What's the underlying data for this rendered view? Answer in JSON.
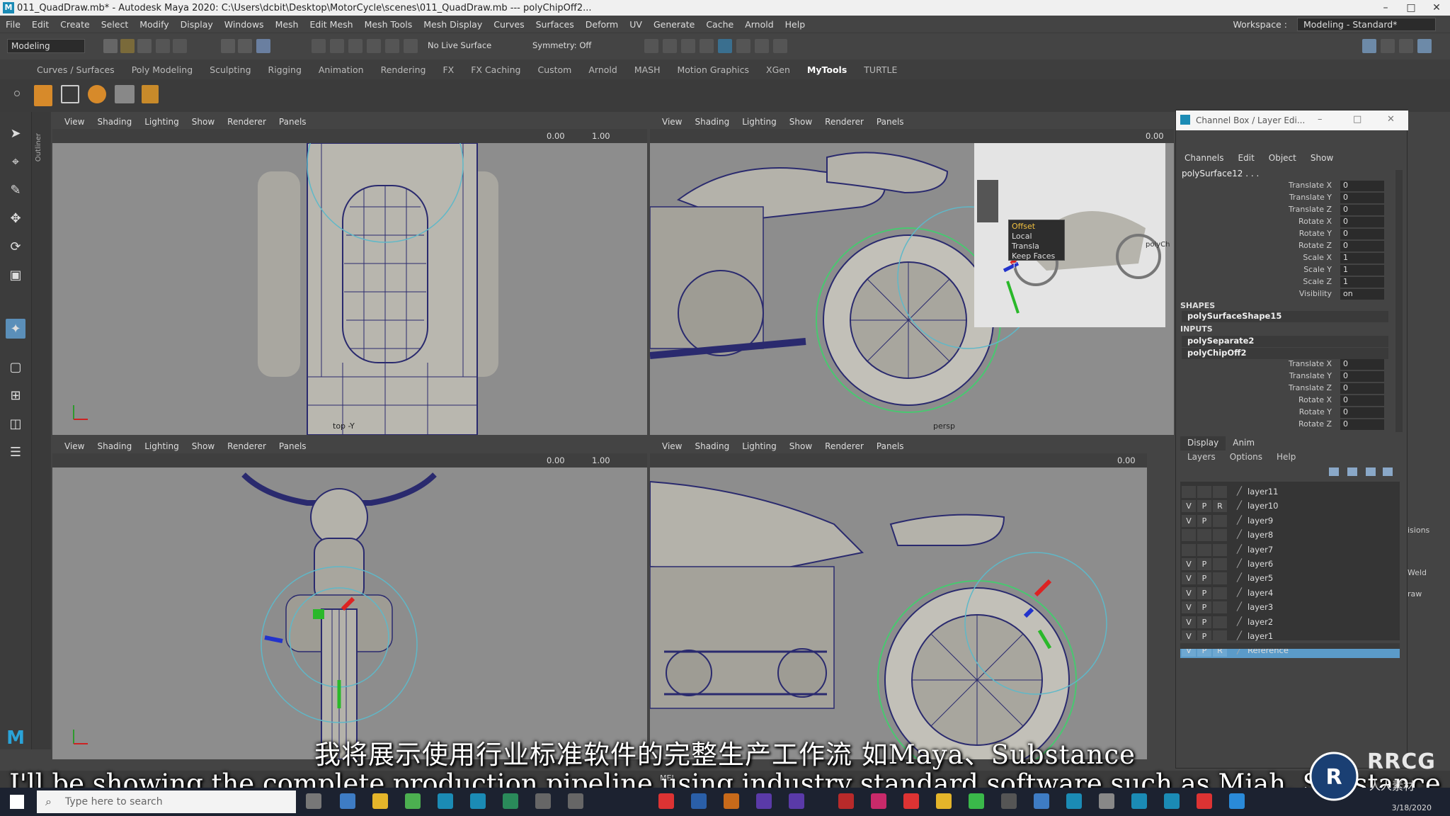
{
  "window": {
    "title": "011_QuadDraw.mb* - Autodesk Maya 2020: C:\\Users\\dcbit\\Desktop\\MotorCycle\\scenes\\011_QuadDraw.mb   ---   polyChipOff2...",
    "controls": [
      "–",
      "□",
      "✕"
    ]
  },
  "menubar": {
    "items": [
      "File",
      "Edit",
      "Create",
      "Select",
      "Modify",
      "Display",
      "Windows",
      "Mesh",
      "Edit Mesh",
      "Mesh Tools",
      "Mesh Display",
      "Curves",
      "Surfaces",
      "Deform",
      "UV",
      "Generate",
      "Cache",
      "Arnold",
      "Help"
    ],
    "workspace_label": "Workspace :",
    "workspace_value": "Modeling - Standard*"
  },
  "statusline": {
    "mode": "Modeling",
    "live_surface": "No Live Surface",
    "symmetry": "Symmetry: Off"
  },
  "shelf": {
    "tabs": [
      "Curves / Surfaces",
      "Poly Modeling",
      "Sculpting",
      "Rigging",
      "Animation",
      "Rendering",
      "FX",
      "FX Caching",
      "Custom",
      "Arnold",
      "MASH",
      "Motion Graphics",
      "XGen",
      "MyTools",
      "TURTLE"
    ],
    "active": "MyTools"
  },
  "toolbox": {
    "outliner_label": "Outliner"
  },
  "viewport_menu": [
    "View",
    "Shading",
    "Lighting",
    "Show",
    "Renderer",
    "Panels"
  ],
  "viewport_values": {
    "near": "0.00",
    "far": "1.00"
  },
  "viewports": {
    "tl": {
      "camera": "top -Y"
    },
    "tr": {
      "camera": "persp"
    },
    "bl": {
      "camera": ""
    },
    "br": {
      "camera": ""
    }
  },
  "tooltip": {
    "lines": [
      "Offset",
      "Local Transla",
      "Keep Faces T"
    ],
    "node": "polyCh"
  },
  "channelbox": {
    "title": "Channel Box / Layer Edi...",
    "menu": [
      "Channels",
      "Edit",
      "Object",
      "Show"
    ],
    "object": "polySurface12 . . .",
    "attrs": [
      {
        "name": "Translate X",
        "value": "0"
      },
      {
        "name": "Translate Y",
        "value": "0"
      },
      {
        "name": "Translate Z",
        "value": "0"
      },
      {
        "name": "Rotate X",
        "value": "0"
      },
      {
        "name": "Rotate Y",
        "value": "0"
      },
      {
        "name": "Rotate Z",
        "value": "0"
      },
      {
        "name": "Scale X",
        "value": "1"
      },
      {
        "name": "Scale Y",
        "value": "1"
      },
      {
        "name": "Scale Z",
        "value": "1"
      },
      {
        "name": "Visibility",
        "value": "on"
      }
    ],
    "shapes_label": "SHAPES",
    "shape": "polySurfaceShape15",
    "inputs_label": "INPUTS",
    "inputs": [
      "polySeparate2",
      "polyChipOff2"
    ],
    "input_attrs": [
      {
        "name": "Translate X",
        "value": "0"
      },
      {
        "name": "Translate Y",
        "value": "0"
      },
      {
        "name": "Translate Z",
        "value": "0"
      },
      {
        "name": "Rotate X",
        "value": "0"
      },
      {
        "name": "Rotate Y",
        "value": "0"
      },
      {
        "name": "Rotate Z",
        "value": "0"
      }
    ]
  },
  "layer_editor": {
    "tabs": [
      "Display",
      "Anim"
    ],
    "menu": [
      "Layers",
      "Options",
      "Help"
    ],
    "layers": [
      {
        "v": "",
        "p": "",
        "r": "",
        "name": "layer11"
      },
      {
        "v": "V",
        "p": "P",
        "r": "R",
        "name": "layer10"
      },
      {
        "v": "V",
        "p": "P",
        "r": "",
        "name": "layer9"
      },
      {
        "v": "",
        "p": "",
        "r": "",
        "name": "layer8"
      },
      {
        "v": "",
        "p": "",
        "r": "",
        "name": "layer7"
      },
      {
        "v": "V",
        "p": "P",
        "r": "",
        "name": "layer6"
      },
      {
        "v": "V",
        "p": "P",
        "r": "",
        "name": "layer5"
      },
      {
        "v": "V",
        "p": "P",
        "r": "",
        "name": "layer4"
      },
      {
        "v": "V",
        "p": "P",
        "r": "",
        "name": "layer3"
      },
      {
        "v": "V",
        "p": "P",
        "r": "",
        "name": "layer2"
      },
      {
        "v": "V",
        "p": "P",
        "r": "",
        "name": "layer1"
      },
      {
        "v": "V",
        "p": "P",
        "r": "R",
        "name": "Reference"
      }
    ],
    "selected": "Reference"
  },
  "side_panel": {
    "items": [
      "isions",
      "Weld",
      "raw"
    ]
  },
  "subtitles": {
    "zh": "我将展示使用行业标准软件的完整生产工作流 如Maya、Substance",
    "en": "I'll be showing the complete production pipeline using industry standard software such as Miah, Substance"
  },
  "cmdline": {
    "label": "MEL"
  },
  "taskbar": {
    "search_placeholder": "Type here to search",
    "date": "3/18/2020"
  },
  "watermark": {
    "brand": "RRCG",
    "sub": "人人素材"
  },
  "colors": {
    "viewport_bg": "#8a8a8a",
    "wire": "#2a2a6e",
    "selection": "#5b9bc9",
    "accent": "#1b8bb5"
  }
}
